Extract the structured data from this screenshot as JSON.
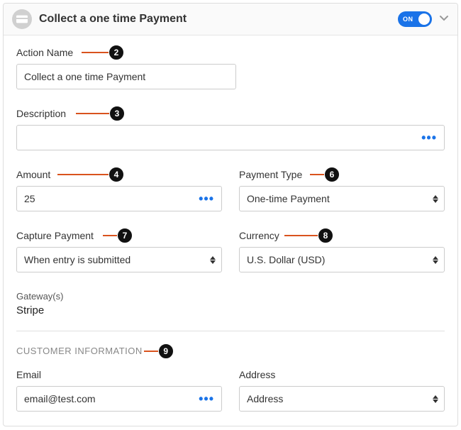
{
  "header": {
    "title": "Collect a one time Payment",
    "toggle_label": "ON"
  },
  "fields": {
    "action_name": {
      "label": "Action Name",
      "value": "Collect a one time Payment"
    },
    "description": {
      "label": "Description",
      "value": ""
    },
    "amount": {
      "label": "Amount",
      "value": "25"
    },
    "payment_type": {
      "label": "Payment Type",
      "value": "One-time Payment"
    },
    "capture_payment": {
      "label": "Capture Payment",
      "value": "When entry is submitted"
    },
    "currency": {
      "label": "Currency",
      "value": "U.S. Dollar (USD)"
    },
    "gateways": {
      "label": "Gateway(s)",
      "value": "Stripe"
    },
    "email": {
      "label": "Email",
      "value": "email@test.com"
    },
    "address": {
      "label": "Address",
      "value": "Address"
    }
  },
  "section": {
    "customer_info": "CUSTOMER INFORMATION"
  },
  "annotations": {
    "a2": "2",
    "a3": "3",
    "a4": "4",
    "a6": "6",
    "a7": "7",
    "a8": "8",
    "a9": "9"
  }
}
